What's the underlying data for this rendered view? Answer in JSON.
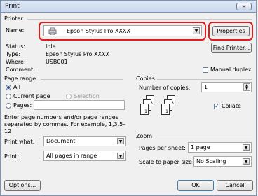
{
  "window": {
    "title": "Print",
    "close_glyph": "✕"
  },
  "printer": {
    "section_label": "Printer",
    "name_label": "Name:",
    "name_value": "Epson Stylus Pro XXXX",
    "properties_label": "Properties",
    "status_label": "Status:",
    "status_value": "Idle",
    "type_label": "Type:",
    "type_value": "Epson Stylus Pro XXXX",
    "where_label": "Where:",
    "where_value": "USB001",
    "comment_label": "Comment:",
    "find_printer_label": "Find Printer...",
    "manual_duplex_label": "Manual duplex"
  },
  "page_range": {
    "section_label": "Page range",
    "all_label": "All",
    "current_page_label": "Current page",
    "selection_label": "Selection",
    "pages_label": "Pages:",
    "hint": "Enter page numbers and/or page ranges separated by commas.  For example, 1,3,5–12"
  },
  "copies": {
    "section_label": "Copies",
    "number_label": "Number of copies:",
    "number_value": "1",
    "collate_label": "Collate",
    "collate_checked": true,
    "page_numbers": [
      "3",
      "3",
      "2",
      "2",
      "1",
      "1"
    ]
  },
  "print_what": {
    "label": "Print what:",
    "value": "Document"
  },
  "print": {
    "label": "Print:",
    "value": "All pages in range"
  },
  "zoom": {
    "section_label": "Zoom",
    "pages_per_sheet_label": "Pages per sheet:",
    "pages_per_sheet_value": "1 page",
    "scale_label": "Scale to paper size:",
    "scale_value": "No Scaling"
  },
  "buttons": {
    "options": "Options...",
    "ok": "OK",
    "cancel": "Cancel"
  }
}
